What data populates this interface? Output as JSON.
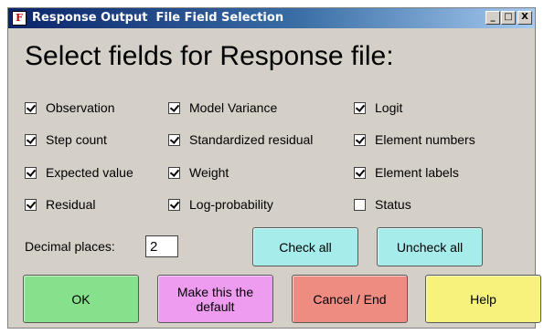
{
  "window": {
    "title": "Response Output  File Field Selection",
    "app_icon_glyph": "F",
    "controls": {
      "minimize": "_",
      "maximize": "□",
      "close": "X"
    }
  },
  "heading": "Select fields for Response file:",
  "fields": {
    "column1": [
      {
        "label": "Observation",
        "checked": true
      },
      {
        "label": "Step count",
        "checked": true
      },
      {
        "label": "Expected value",
        "checked": true
      },
      {
        "label": "Residual",
        "checked": true
      }
    ],
    "column2": [
      {
        "label": "Model Variance",
        "checked": true
      },
      {
        "label": "Standardized residual",
        "checked": true
      },
      {
        "label": "Weight",
        "checked": true
      },
      {
        "label": "Log-probability",
        "checked": true
      }
    ],
    "column3": [
      {
        "label": "Logit",
        "checked": true
      },
      {
        "label": "Element numbers",
        "checked": true
      },
      {
        "label": "Element labels",
        "checked": true
      },
      {
        "label": "Status",
        "checked": false
      }
    ]
  },
  "decimal": {
    "label": "Decimal places:",
    "value": "2"
  },
  "buttons": {
    "check_all": "Check all",
    "uncheck_all": "Uncheck all",
    "ok": "OK",
    "make_default": "Make this  the\ndefault",
    "cancel": "Cancel / End",
    "help": "Help"
  },
  "colors": {
    "check_all": "#a6ecea",
    "uncheck_all": "#a6ecea",
    "ok": "#86e08c",
    "make_default": "#ee9cf0",
    "cancel": "#ee8c82",
    "help": "#f6f27c"
  }
}
